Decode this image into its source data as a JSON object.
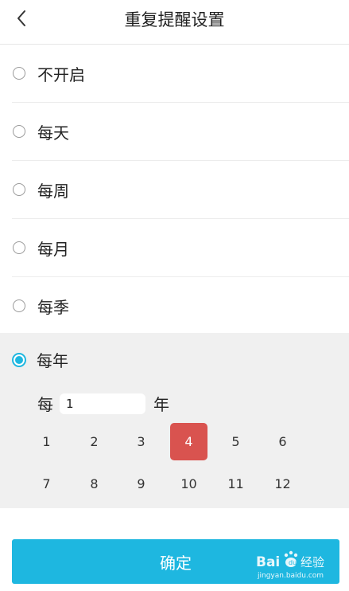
{
  "header": {
    "title": "重复提醒设置",
    "back_icon": "chevron-left-icon"
  },
  "options": [
    {
      "label": "不开启",
      "selected": false
    },
    {
      "label": "每天",
      "selected": false
    },
    {
      "label": "每周",
      "selected": false
    },
    {
      "label": "每月",
      "selected": false
    },
    {
      "label": "每季",
      "selected": false
    },
    {
      "label": "每年",
      "selected": true
    }
  ],
  "yearly": {
    "every_prefix": "每",
    "interval_value": "1",
    "every_suffix": "年",
    "months": [
      "1",
      "2",
      "3",
      "4",
      "5",
      "6",
      "7",
      "8",
      "9",
      "10",
      "11",
      "12"
    ],
    "selected_month": "4"
  },
  "confirm_label": "确定",
  "watermark": {
    "brand": "Bai du 经验",
    "url": "jingyan.baidu.com"
  },
  "colors": {
    "accent": "#1eb7e0",
    "selected_month": "#d9534f",
    "panel_bg": "#f0f0f0"
  }
}
